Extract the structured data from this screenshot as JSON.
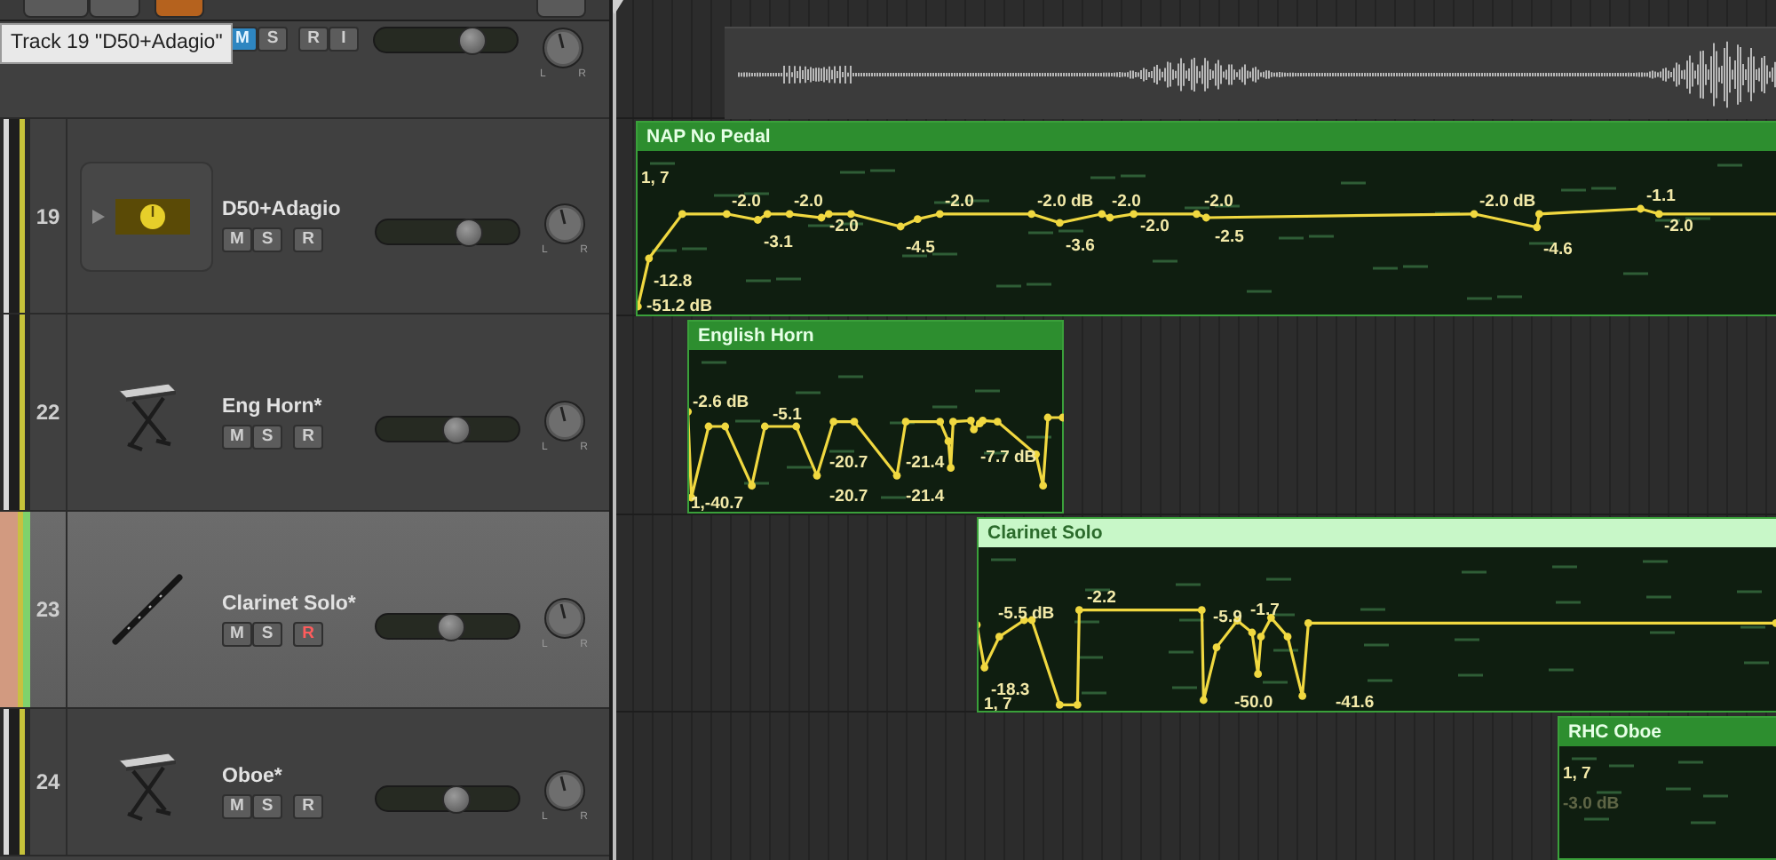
{
  "tooltip": "Track 19 \"D50+Adagio\"",
  "partial_track": {
    "buttons": [
      {
        "label": "M",
        "kind": "mute",
        "on": true
      },
      {
        "label": "S",
        "kind": "solo",
        "on": false
      },
      {
        "label": "R",
        "kind": "record",
        "on": false
      },
      {
        "label": "I",
        "kind": "input",
        "on": false
      }
    ],
    "level": 0.74,
    "pan_labels": [
      "L",
      "R"
    ]
  },
  "tracks": [
    {
      "number": "19",
      "name": "D50+Adagio",
      "kind": "synth",
      "selected": false,
      "buttons": [
        {
          "label": "M",
          "kind": "mute",
          "on": false
        },
        {
          "label": "S",
          "kind": "solo",
          "on": false
        },
        {
          "label": "R",
          "kind": "record",
          "on": false
        }
      ],
      "level": 0.68,
      "pan_labels": [
        "L",
        "R"
      ]
    },
    {
      "number": "22",
      "name": "Eng Horn*",
      "kind": "keyboard",
      "selected": false,
      "buttons": [
        {
          "label": "M",
          "kind": "mute",
          "on": false
        },
        {
          "label": "S",
          "kind": "solo",
          "on": false
        },
        {
          "label": "R",
          "kind": "record",
          "on": false
        }
      ],
      "level": 0.58,
      "pan_labels": [
        "L",
        "R"
      ]
    },
    {
      "number": "23",
      "name": "Clarinet Solo*",
      "kind": "clarinet",
      "selected": true,
      "buttons": [
        {
          "label": "M",
          "kind": "mute",
          "on": false
        },
        {
          "label": "S",
          "kind": "solo",
          "on": false
        },
        {
          "label": "R",
          "kind": "record",
          "on": true
        }
      ],
      "level": 0.53,
      "pan_labels": [
        "L",
        "R"
      ]
    },
    {
      "number": "24",
      "name": "Oboe*",
      "kind": "keyboard",
      "selected": false,
      "buttons": [
        {
          "label": "M",
          "kind": "mute",
          "on": false
        },
        {
          "label": "S",
          "kind": "solo",
          "on": false
        },
        {
          "label": "R",
          "kind": "record",
          "on": false
        }
      ],
      "level": 0.58,
      "pan_labels": [
        "L",
        "R"
      ]
    }
  ],
  "regions": [
    {
      "kind": "audio"
    },
    {
      "kind": "automation",
      "name": "NAP No Pedal",
      "selected": false,
      "labels": [
        "1, 7",
        "-2.0",
        "-2.0",
        "-3.1",
        "-2.0",
        "-4.5",
        "-2.0",
        "-2.0 dB",
        "-3.6",
        "-2.0",
        "-2.0",
        "-2.0",
        "-2.5",
        "-2.0 dB",
        "-4.6",
        "-1.1",
        "-2.0",
        "-12.8",
        "-51.2 dB"
      ]
    },
    {
      "kind": "automation",
      "name": "English Horn",
      "selected": false,
      "labels": [
        "-2.6 dB",
        "-5.1",
        "-20.7",
        "-20.7",
        "-21.4",
        "-21.4",
        "-7.7 dB",
        "1,-40.7"
      ]
    },
    {
      "kind": "automation",
      "name": "Clarinet Solo",
      "selected": true,
      "labels": [
        "-5.5 dB",
        "-2.2",
        "-18.3",
        "1, 7",
        "-5.9",
        "-1.7",
        "-50.0",
        "-41.6"
      ]
    },
    {
      "kind": "automation",
      "name": "RHC Oboe",
      "selected": false,
      "labels": [
        "1, 7"
      ],
      "faded_labels": [
        "-3.0 dB"
      ]
    }
  ]
}
